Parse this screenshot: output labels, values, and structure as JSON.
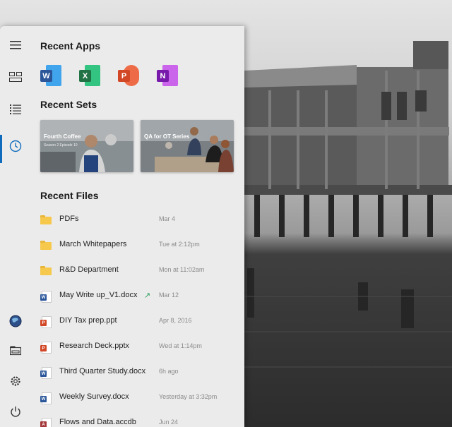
{
  "colors": {
    "panel_bg": "#ebebeb",
    "accent": "#0f6cbd",
    "word": "#2b579a",
    "excel": "#217346",
    "powerpoint": "#d24726",
    "onenote": "#7719aa",
    "access": "#a4373a",
    "folder": "#f6c84c",
    "trend": "#2a9d5c"
  },
  "rail": {
    "items": [
      {
        "icon": "hamburger-menu-icon"
      },
      {
        "icon": "tiles-icon"
      },
      {
        "icon": "list-icon"
      },
      {
        "icon": "clock-icon",
        "active": true
      },
      {
        "icon": "globe-icon"
      },
      {
        "icon": "drive-icon"
      },
      {
        "icon": "gear-icon"
      },
      {
        "icon": "power-icon"
      }
    ]
  },
  "recent_apps": {
    "title": "Recent Apps",
    "apps": [
      {
        "letter": "W",
        "icon": "word-icon"
      },
      {
        "letter": "X",
        "icon": "excel-icon"
      },
      {
        "letter": "P",
        "icon": "powerpoint-icon"
      },
      {
        "letter": "N",
        "icon": "onenote-icon"
      }
    ]
  },
  "recent_sets": {
    "title": "Recent Sets",
    "sets": [
      {
        "title": "Fourth Coffee",
        "subtitle": "Season 2 Episode 10"
      },
      {
        "title": "QA for OT Series",
        "subtitle": ""
      }
    ]
  },
  "recent_files": {
    "title": "Recent Files",
    "files": [
      {
        "name": "PDFs",
        "date": "Mar 4",
        "type": "folder",
        "icon": "folder-icon"
      },
      {
        "name": "March Whitepapers",
        "date": "Tue at 2:12pm",
        "type": "folder",
        "icon": "folder-icon"
      },
      {
        "name": "R&D Department",
        "date": "Mon at 11:02am",
        "type": "folder",
        "icon": "folder-icon"
      },
      {
        "name": "May Write up_V1.docx",
        "date": "Mar 12",
        "type": "word",
        "letter": "W",
        "icon": "word-doc-icon",
        "trend": "↗"
      },
      {
        "name": "DIY Tax prep.ppt",
        "date": "Apr 8, 2016",
        "type": "ppt",
        "letter": "P",
        "icon": "ppt-doc-icon"
      },
      {
        "name": "Research Deck.pptx",
        "date": "Wed at 1:14pm",
        "type": "ppt",
        "letter": "P",
        "icon": "ppt-doc-icon"
      },
      {
        "name": "Third Quarter Study.docx",
        "date": "6h ago",
        "type": "word",
        "letter": "W",
        "icon": "word-doc-icon"
      },
      {
        "name": "Weekly Survey.docx",
        "date": "Yesterday at 3:32pm",
        "type": "word",
        "letter": "W",
        "icon": "word-doc-icon"
      },
      {
        "name": "Flows and Data.accdb",
        "date": "Jun 24",
        "type": "access",
        "letter": "A",
        "icon": "access-doc-icon"
      }
    ]
  }
}
